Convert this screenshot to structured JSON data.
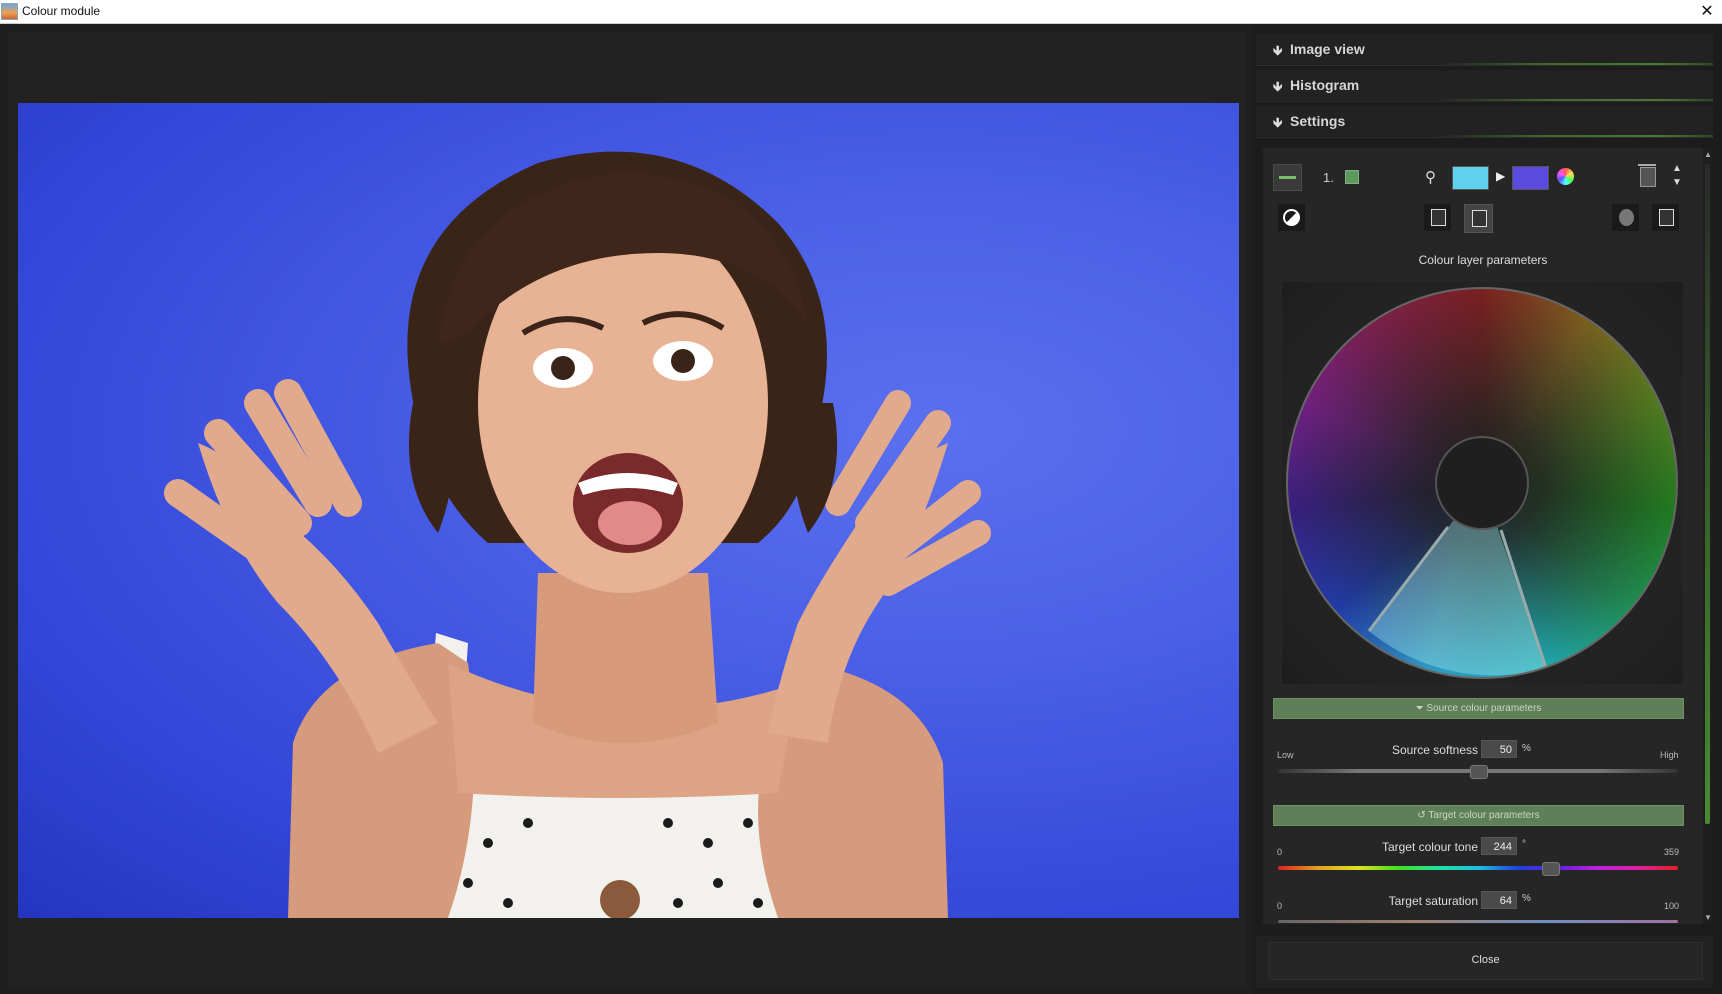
{
  "window": {
    "title": "Colour module"
  },
  "sections": {
    "image_view": "Image view",
    "histogram": "Histogram",
    "settings": "Settings"
  },
  "layer": {
    "number": "1.",
    "source_color": "#5fd1ec",
    "target_color": "#5b4ae0"
  },
  "colour_layer": {
    "title": "Colour layer parameters"
  },
  "source": {
    "header": "Source colour parameters",
    "softness_label": "Source softness",
    "softness_value": "50",
    "softness_unit": "%",
    "low_label": "Low",
    "high_label": "High",
    "softness_fraction": 0.5
  },
  "target": {
    "header": "Target colour parameters",
    "tone_label": "Target colour tone",
    "tone_value": "244",
    "tone_unit": "°",
    "tone_min": "0",
    "tone_max": "359",
    "saturation_label": "Target saturation",
    "saturation_value": "64",
    "saturation_unit": "%",
    "sat_min": "0",
    "sat_max": "100"
  },
  "footer": {
    "close_label": "Close"
  },
  "colors": {
    "accent_green": "#5f7f58",
    "background": "#1b1b1b"
  }
}
